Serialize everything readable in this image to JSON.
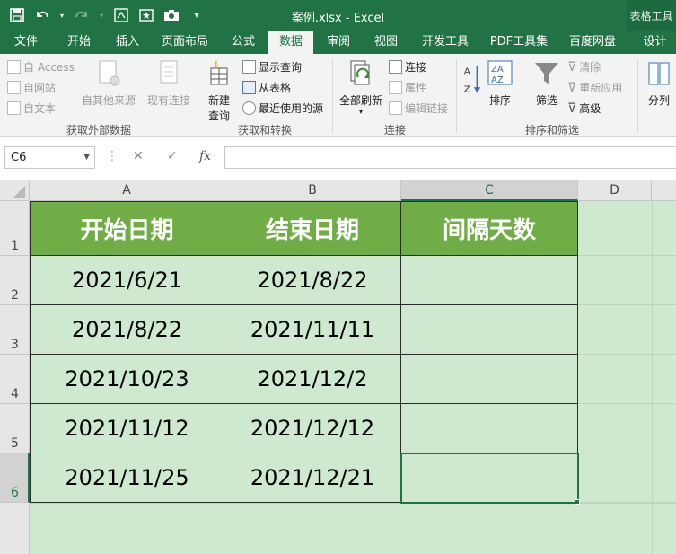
{
  "window": {
    "title": "案例.xlsx - Excel",
    "tool_tab_title": "表格工具"
  },
  "tabs": [
    {
      "label": "文件"
    },
    {
      "label": "开始"
    },
    {
      "label": "插入"
    },
    {
      "label": "页面布局"
    },
    {
      "label": "公式"
    },
    {
      "label": "数据",
      "active": true
    },
    {
      "label": "审阅"
    },
    {
      "label": "视图"
    },
    {
      "label": "开发工具"
    },
    {
      "label": "PDF工具集"
    },
    {
      "label": "百度网盘"
    },
    {
      "label": "设计"
    }
  ],
  "ribbon": {
    "external": {
      "access": "自 Access",
      "web": "自网站",
      "text": "自文本",
      "other": "自其他来源",
      "existing": "现有连接",
      "label": "获取外部数据"
    },
    "transform": {
      "new_query_1": "新建",
      "new_query_2": "查询",
      "show_queries": "显示查询",
      "from_table": "从表格",
      "recent_sources": "最近使用的源",
      "label": "获取和转换"
    },
    "connections": {
      "refresh_all": "全部刷新",
      "connections": "连接",
      "properties": "属性",
      "edit_links": "编辑链接",
      "label": "连接"
    },
    "sort_filter": {
      "sort": "排序",
      "filter": "筛选",
      "clear": "清除",
      "reapply": "重新应用",
      "advanced": "高级",
      "label": "排序和筛选"
    },
    "data_tools": {
      "split": "分列"
    }
  },
  "formula_bar": {
    "name_box": "C6",
    "cancel": "✕",
    "enter": "✓",
    "fx": "fx",
    "value": ""
  },
  "sheet": {
    "columns": [
      "A",
      "B",
      "C",
      "D"
    ],
    "rows": [
      "1",
      "2",
      "3",
      "4",
      "5",
      "6"
    ],
    "headers": [
      "开始日期",
      "结束日期",
      "间隔天数"
    ],
    "data": [
      [
        "2021/6/21",
        "2021/8/22",
        ""
      ],
      [
        "2021/8/22",
        "2021/11/11",
        ""
      ],
      [
        "2021/10/23",
        "2021/12/2",
        ""
      ],
      [
        "2021/11/12",
        "2021/12/12",
        ""
      ],
      [
        "2021/11/25",
        "2021/12/21",
        ""
      ]
    ],
    "selected_cell": "C6"
  },
  "colors": {
    "accent": "#217346",
    "header_fill": "#70ad47",
    "cell_fill": "#cfe8d0"
  }
}
